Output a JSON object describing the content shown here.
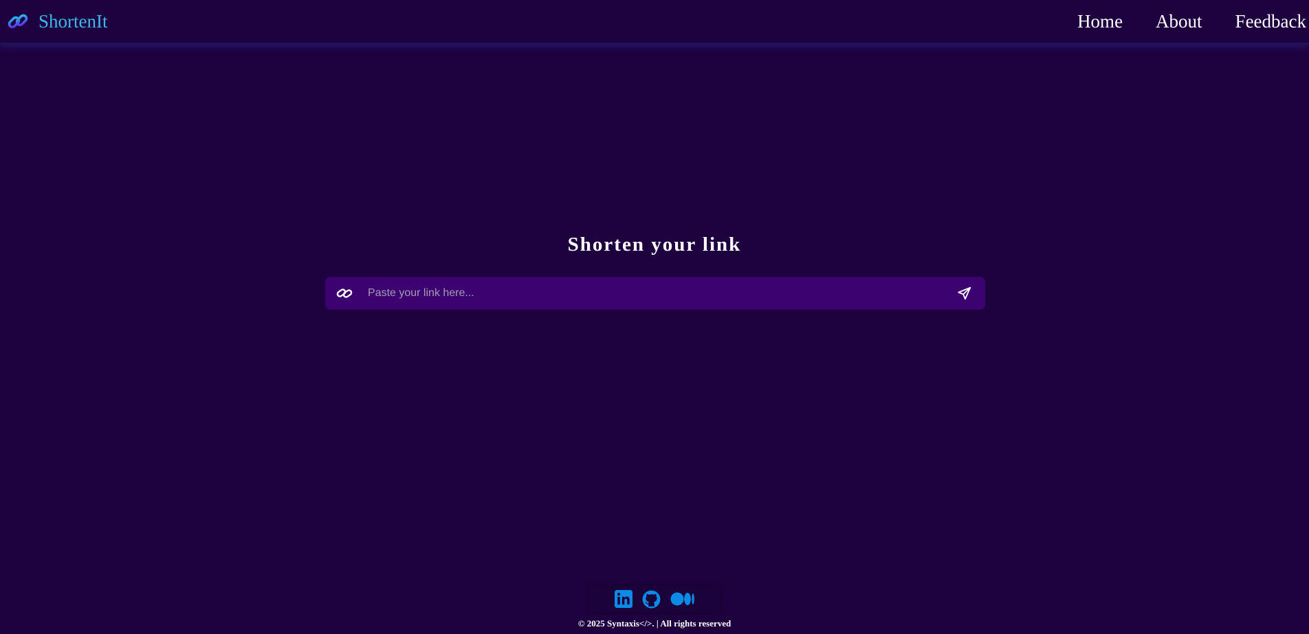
{
  "colors": {
    "background": "#1e023f",
    "brand_text": "#3fb6ee",
    "input_background": "#3c0270",
    "social_icon": "#0a8be7"
  },
  "navbar": {
    "brand": {
      "icon": "link-icon",
      "label": "ShortenIt"
    },
    "links": [
      {
        "label": "Home"
      },
      {
        "label": "About"
      },
      {
        "label": "Feedback"
      }
    ]
  },
  "main": {
    "title": "Shorten your link",
    "input": {
      "icon": "link-icon",
      "value": "",
      "placeholder": "Paste your link here...",
      "submit_icon": "send-icon"
    }
  },
  "footer": {
    "social_icons": [
      "linkedin-icon",
      "github-icon",
      "medium-icon"
    ],
    "copyright": "© 2025 Syntaxis</>. | All rights reserved"
  }
}
